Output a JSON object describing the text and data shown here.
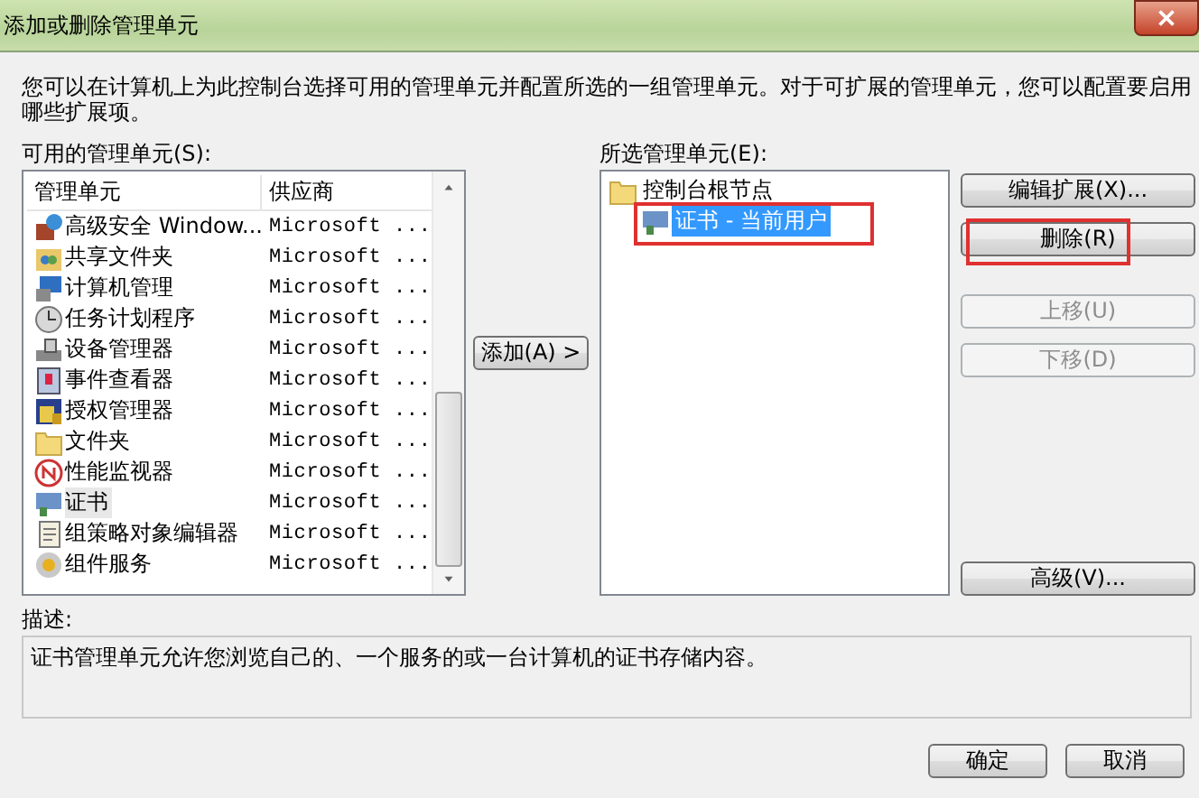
{
  "window": {
    "title": "添加或删除管理单元"
  },
  "intro": "您可以在计算机上为此控制台选择可用的管理单元并配置所选的一组管理单元。对于可扩展的管理单元，您可以配置要启用哪些扩展项。",
  "available": {
    "label": "可用的管理单元(S):",
    "columns": [
      "管理单元",
      "供应商"
    ],
    "rows": [
      {
        "name": "高级安全 Window...",
        "vendor": "Microsoft ...",
        "selected": false
      },
      {
        "name": "共享文件夹",
        "vendor": "Microsoft ...",
        "selected": false
      },
      {
        "name": "计算机管理",
        "vendor": "Microsoft ...",
        "selected": false
      },
      {
        "name": "任务计划程序",
        "vendor": "Microsoft ...",
        "selected": false
      },
      {
        "name": "设备管理器",
        "vendor": "Microsoft ...",
        "selected": false
      },
      {
        "name": "事件查看器",
        "vendor": "Microsoft ...",
        "selected": false
      },
      {
        "name": "授权管理器",
        "vendor": "Microsoft ...",
        "selected": false
      },
      {
        "name": "文件夹",
        "vendor": "Microsoft ...",
        "selected": false
      },
      {
        "name": "性能监视器",
        "vendor": "Microsoft ...",
        "selected": false
      },
      {
        "name": "证书",
        "vendor": "Microsoft ...",
        "selected": true
      },
      {
        "name": "组策略对象编辑器",
        "vendor": "Microsoft ...",
        "selected": false
      },
      {
        "name": "组件服务",
        "vendor": "Microsoft ...",
        "selected": false
      }
    ]
  },
  "add_button": "添加(A) >",
  "selected_panel": {
    "label": "所选管理单元(E):",
    "tree": [
      {
        "label": "控制台根节点",
        "selected": false,
        "highlighted": false,
        "children": [
          {
            "label": "证书 - 当前用户",
            "selected": true,
            "highlighted": true
          }
        ]
      }
    ]
  },
  "buttons": [
    {
      "label": "编辑扩展(X)...",
      "disabled": false,
      "highlighted": false
    },
    {
      "label": "删除(R)",
      "disabled": false,
      "highlighted": true
    },
    {
      "label": "上移(U)",
      "disabled": true,
      "highlighted": false
    },
    {
      "label": "下移(D)",
      "disabled": true,
      "highlighted": false
    },
    {
      "label": "高级(V)...",
      "disabled": false,
      "highlighted": false
    }
  ],
  "description": {
    "label": "描述:",
    "text": "证书管理单元允许您浏览自己的、一个服务的或一台计算机的证书存储内容。"
  },
  "footer_buttons": [
    "确定",
    "取消"
  ]
}
